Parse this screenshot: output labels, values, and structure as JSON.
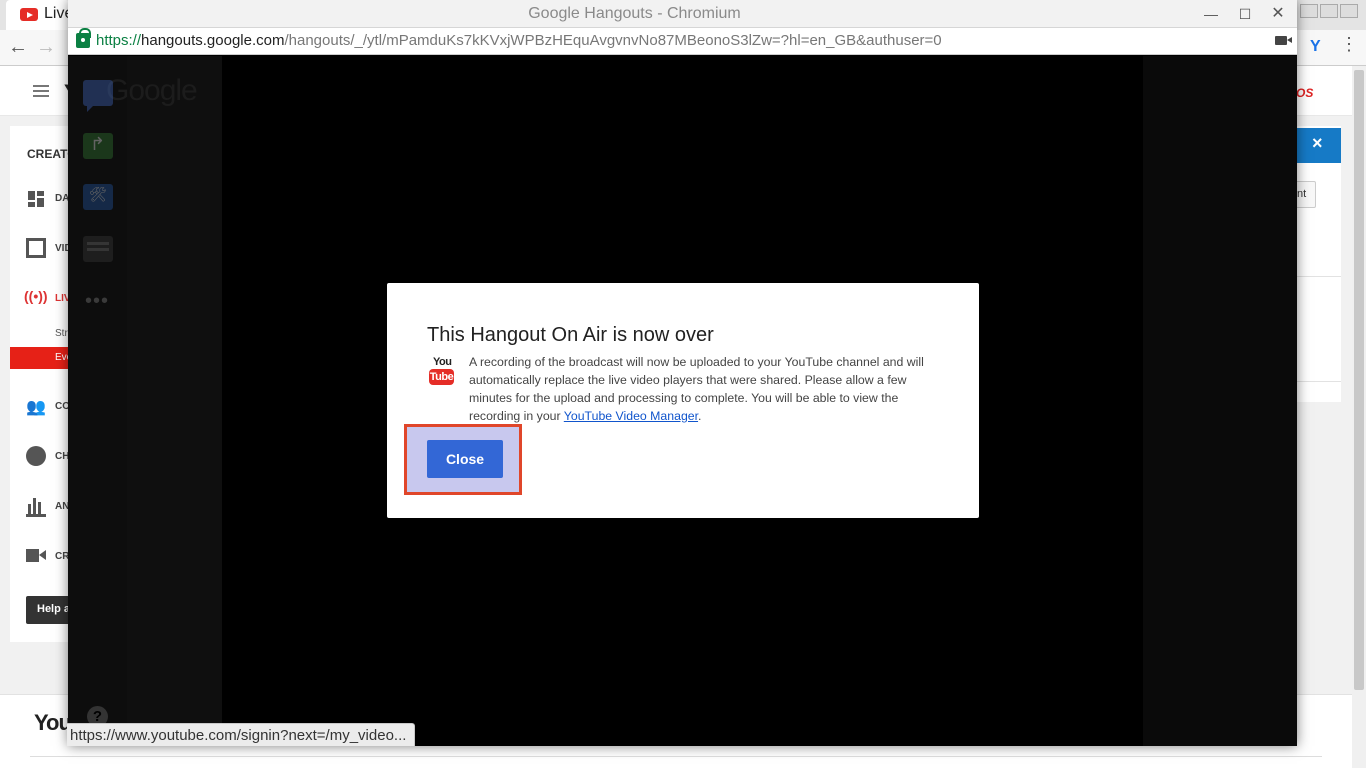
{
  "background_window": {
    "tab_title": "Live",
    "creator_heading": "CREATO",
    "sidebar_items": [
      {
        "label": "DA",
        "icon": "dashboard-icon"
      },
      {
        "label": "VID",
        "icon": "video-manager-icon"
      },
      {
        "label": "LIV",
        "icon": "live-broadcast-icon"
      },
      {
        "label": "CO",
        "icon": "community-icon"
      },
      {
        "label": "CH",
        "icon": "channel-icon"
      },
      {
        "label": "AN",
        "icon": "analytics-icon"
      },
      {
        "label": "CR",
        "icon": "create-icon"
      }
    ],
    "sub_stream": "Str",
    "sub_events": "Eve",
    "help_button": "Help a",
    "right_button": "nt",
    "right_close": "×",
    "footer_logo": "You"
  },
  "popup": {
    "window_title": "Google Hangouts - Chromium",
    "url_scheme": "https://",
    "url_host": "hangouts.google.com",
    "url_path": "/hangouts/_/ytl/mPamduKs7kKVxjWPBzHEquAvgvnvNo87MBeonoS3lZw=?hl=en_GB&authuser=0",
    "bg_logo": "Google",
    "more_dots": "•••",
    "help_glyph": "?"
  },
  "dialog": {
    "title": "This Hangout On Air is now over",
    "logo_you": "You",
    "logo_tube": "Tube",
    "body_text": "A recording of the broadcast will now be uploaded to your YouTube channel and will automatically replace the live video players that were shared. Please allow a few minutes for the upload and processing to complete. You will be able to view the recording in your",
    "link_text": "YouTube Video Manager",
    "body_end": ".",
    "close_button": "Close"
  },
  "status_bar": {
    "url": "https://www.youtube.com/signin?next=/my_video..."
  },
  "colors": {
    "youtube_red": "#e52d27",
    "button_blue": "#3367d6",
    "highlight_border": "#e0462a",
    "highlight_fill": "#c8c8ee"
  }
}
